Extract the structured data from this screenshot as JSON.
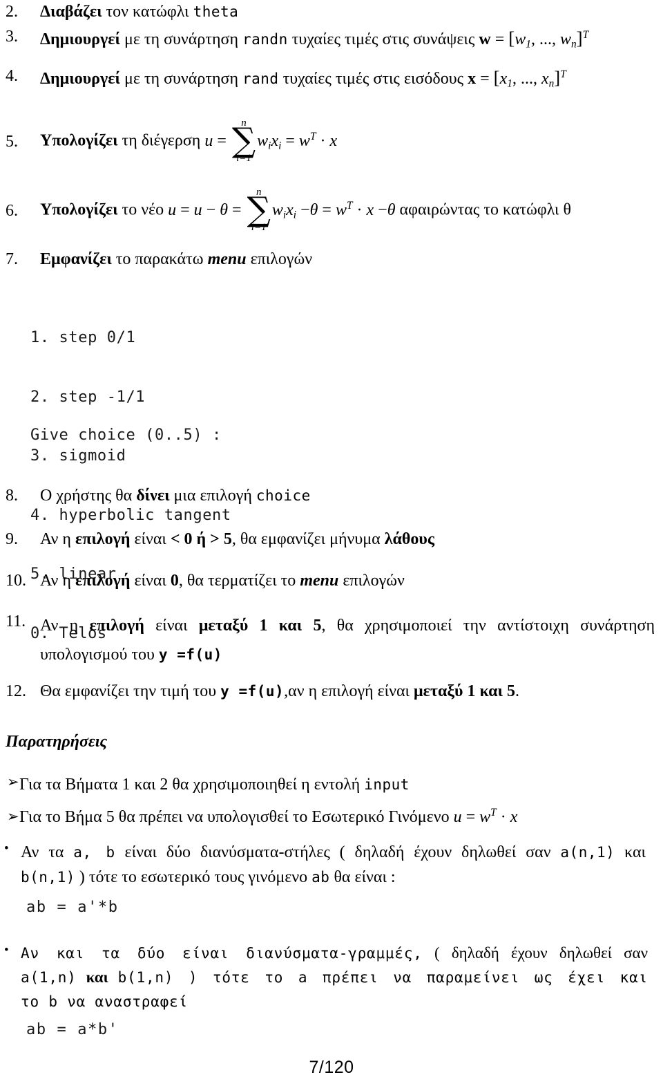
{
  "document": {
    "language": "el",
    "page_label": "7/120"
  },
  "steps": [
    {
      "number": "2.",
      "bold_lead": "Διαβάζει",
      "text_mid": " τον κατώφλι ",
      "code": "theta"
    },
    {
      "number": "3.",
      "bold_lead": "Δημιουργεί",
      "text_mid": " με τη συνάρτηση ",
      "code": "randn",
      "text_after": " τυχαίες τιμές στις συνάψεις ",
      "math": {
        "vec": "w",
        "eq": "=",
        "open": "[",
        "v1": "w",
        "v1sub": "1",
        "dots": ", ..., ",
        "v2": "w",
        "v2sub": "n",
        "close": "]",
        "sup": "T"
      }
    },
    {
      "number": "4.",
      "bold_lead": "Δημιουργεί",
      "text_mid": " με τη συνάρτηση ",
      "code": "rand",
      "text_after": " τυχαίες τιμές στις εισόδους  ",
      "math": {
        "vec": "x",
        "eq": "=",
        "open": "[",
        "v1": "x",
        "v1sub": "1",
        "dots": ", ..., ",
        "v2": "x",
        "v2sub": "n",
        "close": "]",
        "sup": "T"
      }
    },
    {
      "number": "5.",
      "bold_lead": "Υπολογίζει",
      "text_mid": " τη διέγερση  ",
      "formula": {
        "lhs": "u",
        "eq1": "=",
        "sum_top": "n",
        "sum_bottom": "i=1",
        "term_w": "w",
        "term_w_sub": "i",
        "term_x": "x",
        "term_x_sub": "i",
        "eq2": "=",
        "rhs_w": "w",
        "rhs_sup": "T",
        "dot": "·",
        "rhs_x": "x"
      }
    },
    {
      "number": "6.",
      "bold_lead": "Υπολογίζει",
      "text_mid": " το νέο  ",
      "formula": {
        "lhs": "u",
        "eq0": "=",
        "u2": "u",
        "minus1": "−",
        "theta1": "θ",
        "eq1": "=",
        "sum_top": "n",
        "sum_bottom": "i=1",
        "term_w": "w",
        "term_w_sub": "i",
        "term_x": "x",
        "term_x_sub": "i",
        "minus2": "−",
        "theta2": "θ",
        "eq2": "=",
        "rhs_w": "w",
        "rhs_sup": "T",
        "dot": "·",
        "rhs_x": "x",
        "minus3": "−",
        "theta3": "θ"
      },
      "text_tail": " αφαιρώντας το κατώφλι θ"
    },
    {
      "number": "7.",
      "bold_lead": "Εμφανίζει",
      "text_mid": " το παρακάτω ",
      "bold_italic": "menu",
      "text_after": " επιλογών"
    }
  ],
  "menu_block": {
    "options": [
      "1. step 0/1",
      "2. step -1/1",
      "3. sigmoid",
      "4. hyperbolic tangent",
      "5. linear",
      "0. Telos"
    ],
    "prompt": "Give choice (0..5) :"
  },
  "steps2": [
    {
      "number": "8.",
      "pre": "Ο χρήστης θα ",
      "bold": "δίνει",
      "mid": " μια επιλογή ",
      "code": "choice"
    },
    {
      "number": "9.",
      "pre": "Αν η ",
      "bold": "επιλογή",
      "mid": " είναι ",
      "bold2": "<  0 ή >  5",
      "mid2": ", θα εμφανίζει μήνυμα ",
      "bold3": "λάθους"
    },
    {
      "number": "10.",
      "pre": "Αν η ",
      "bold": "επιλογή",
      "mid": " είναι ",
      "bold2": "0",
      "mid2": ", θα τερματίζει το ",
      "bold_italic": "menu",
      "tail": " επιλογών"
    },
    {
      "number": "11.",
      "line1_pre": "Αν η ",
      "line1_bold": "επιλογή",
      "line1_mid": " είναι ",
      "line1_bold2": "μεταξύ 1 και 5",
      "line1_tail": ", θα χρησιμοποιεί την αντίστοιχη συνάρτηση",
      "line2_pre": "υπολογισμού του ",
      "line2_code": "y =f(u)"
    },
    {
      "number": "12.",
      "pre": "Θα εμφανίζει την τιμή του ",
      "code": "y =f(u)",
      "mid": ",αν η επιλογή είναι  ",
      "bold": "μεταξύ 1 και 5",
      "tail": "."
    }
  ],
  "remarks": {
    "title": "Παρατηρήσεις",
    "arrow_glyph": "➢",
    "dot_glyph": "•",
    "arrow_items": [
      {
        "pre": "Για τα Βήματα 1 και 2 θα χρησιμοποιηθεί η εντολή ",
        "code": "input"
      },
      {
        "pre": "Για το Βήμα 5 θα πρέπει να υπολογισθεί το Εσωτερικό Γινόμενο ",
        "math": {
          "lhs": "u",
          "eq": "=",
          "w": "w",
          "sup": "T",
          "dot": "·",
          "x": "x"
        }
      }
    ],
    "dot_items": [
      {
        "line1_a": "Αν τα ",
        "line1_code1": "a, b",
        "line1_b": " είναι δύο διανύσματα-στήλες ( δηλαδή έχουν δηλωθεί σαν ",
        "line1_code2": "a(n,1)",
        "line1_c": " και",
        "line2_code": "b(n,1)",
        "line2_a": " ) τότε το εσωτερικό τους γινόμενο ",
        "line2_code2": "ab",
        "line2_b": "  θα  είναι :",
        "code_result": "ab = a'*b"
      },
      {
        "line1": "Αν και τα δύο είναι διανύσματα-γραμμές,",
        "line1_tail": " ( δηλαδή έχουν δηλωθεί σαν",
        "line2_a": "a(1,n)",
        "line2_b": " και ",
        "line2_c": "b(1,n)",
        "line2_d": " ) τότε το a πρέπει να παραμείνει ως έχει και",
        "line3": "το b να αναστραφεί",
        "code_result": "ab = a*b'"
      }
    ]
  }
}
